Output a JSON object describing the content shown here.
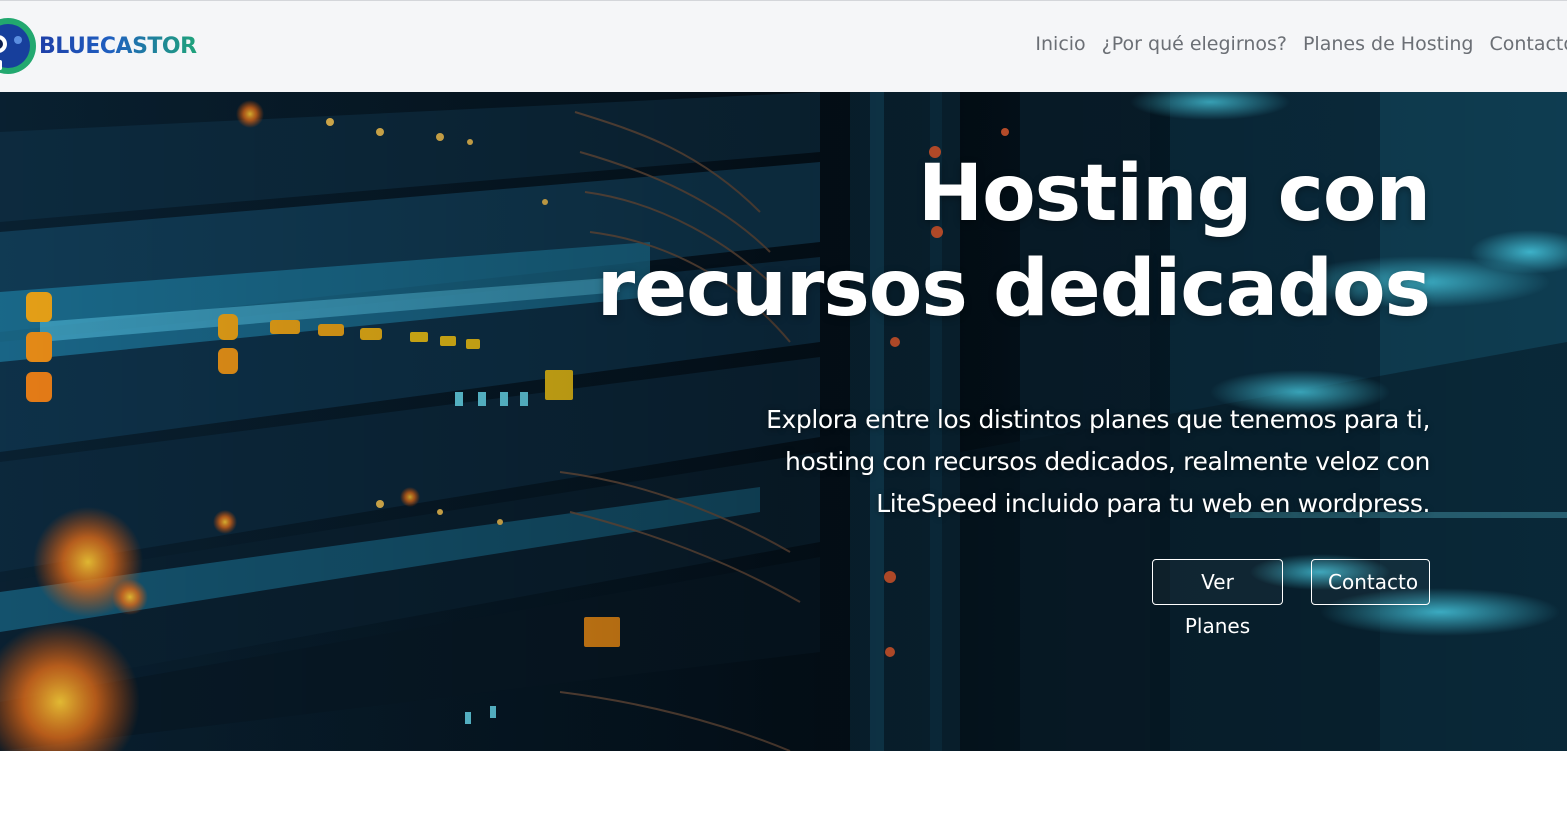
{
  "brand": {
    "logo_text": "BLUECASTOR"
  },
  "nav": {
    "items": [
      {
        "label": "Inicio"
      },
      {
        "label": "¿Por qué elegirnos?"
      },
      {
        "label": "Planes de Hosting"
      },
      {
        "label": "Contacto"
      }
    ]
  },
  "hero": {
    "title_line1": "Hosting con",
    "title_line2": "recursos dedicados",
    "subtitle_line1": "Explora entre los distintos planes que tenemos para ti,",
    "subtitle_line2": "hosting con recursos dedicados, realmente veloz con",
    "subtitle_line3": "LiteSpeed incluido para tu web en wordpress.",
    "primary_button": "Ver Planes",
    "secondary_button": "Contacto"
  },
  "colors": {
    "navbar_bg": "#f5f6f8",
    "nav_text": "#6b6f75",
    "brand_blue": "#1e3fa8",
    "brand_green": "#1fa37a",
    "hero_text": "#ffffff"
  }
}
